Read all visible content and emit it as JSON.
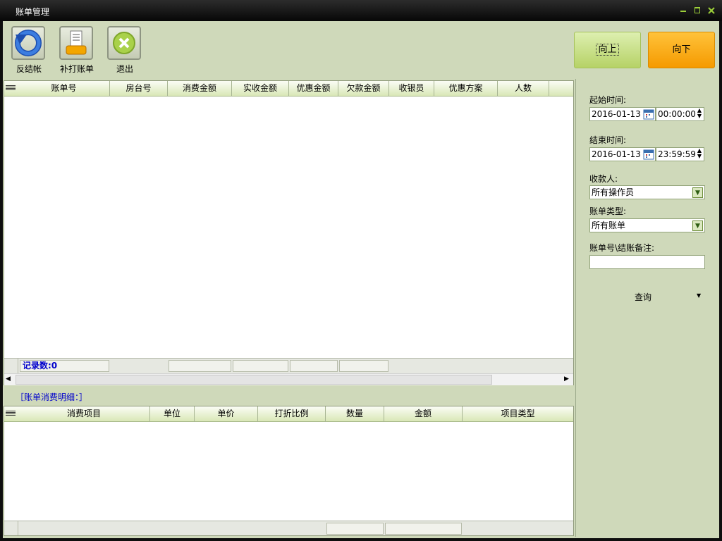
{
  "window": {
    "title": "账单管理"
  },
  "toolbar": {
    "reverse_label": "反结帐",
    "reprint_label": "补打账单",
    "exit_label": "退出"
  },
  "nav": {
    "up_label": "向上",
    "down_label": "向下"
  },
  "bill_table": {
    "columns": [
      "账单号",
      "房台号",
      "消费金额",
      "实收金额",
      "优惠金额",
      "欠款金额",
      "收银员",
      "优惠方案",
      "人数"
    ],
    "record_count": "记录数:0"
  },
  "detail": {
    "section_title": "［账单消费明细：］",
    "columns": [
      "消费项目",
      "单位",
      "单价",
      "打折比例",
      "数量",
      "金额",
      "项目类型"
    ]
  },
  "filters": {
    "start_label": "起始时间:",
    "start_date": "2016-01-13",
    "start_time": "00:00:00",
    "end_label": "结束时间:",
    "end_date": "2016-01-13",
    "end_time": "23:59:59",
    "payee_label": "收款人:",
    "payee_value": "所有操作员",
    "type_label": "账单类型:",
    "type_value": "所有账单",
    "note_label": "账单号\\结账备注:",
    "note_value": "",
    "query_label": "查询"
  },
  "colors": {
    "frame": "#cfd9ba",
    "up_button": "#c5e07e",
    "down_button": "#f7a300",
    "accent_text": "#0000cc"
  }
}
